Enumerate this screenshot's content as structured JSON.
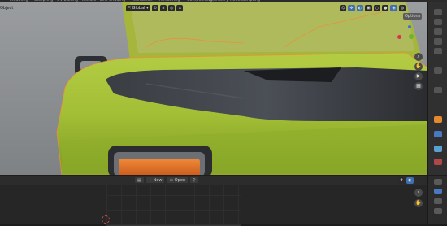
{
  "top_tabs": [
    "Modeling",
    "Sculpting",
    "UV Editing",
    "Texture Paint",
    "Shading",
    "Animation",
    "Rendering",
    "Compositing",
    "Geometry Nodes",
    "Scripting"
  ],
  "viewport": {
    "mode_label": "Object",
    "transform_orientation": "Global",
    "options_label": "Options",
    "icons": [
      "cursor-icon",
      "transform-pivot-icon",
      "snap-icon",
      "proportional-edit-icon",
      "view-object-types-icon",
      "gizmo-icon",
      "overlays-icon",
      "xray-icon",
      "shading-wire-icon",
      "shading-solid-icon",
      "shading-material-icon",
      "shading-rendered-icon"
    ],
    "navigation": [
      "axis-gizmo",
      "zoom-icon",
      "hand-pan-icon",
      "camera-view-icon",
      "grid-view-icon"
    ]
  },
  "bottom_editor": {
    "new_label": "New",
    "open_label": "Open"
  },
  "properties_tabs": [
    "tool-icon",
    "render-icon",
    "output-icon",
    "view-layer-icon",
    "scene-icon",
    "world-icon",
    "object-icon",
    "modifier-icon",
    "particles-icon",
    "physics-icon",
    "constraints-icon",
    "data-icon",
    "material-icon"
  ],
  "colors": {
    "car_body": "#a7c43a",
    "selection_outline": "#e8913a",
    "accent_blue": "#3f6fb0"
  }
}
